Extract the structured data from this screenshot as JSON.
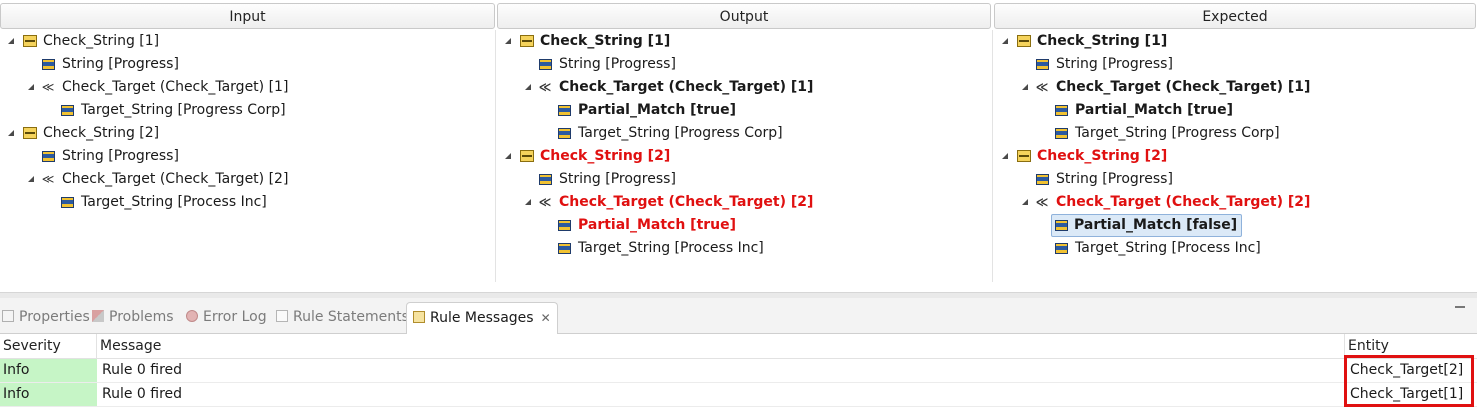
{
  "panels": {
    "input": {
      "title": "Input",
      "rows": [
        {
          "label": "Check_String [1]"
        },
        {
          "label": "String [Progress]"
        },
        {
          "label": "Check_Target (Check_Target) [1]"
        },
        {
          "label": "Target_String [Progress Corp]"
        },
        {
          "label": "Check_String [2]"
        },
        {
          "label": "String [Progress]"
        },
        {
          "label": "Check_Target (Check_Target) [2]"
        },
        {
          "label": "Target_String [Process Inc]"
        }
      ]
    },
    "output": {
      "title": "Output",
      "rows": [
        {
          "label": "Check_String [1]"
        },
        {
          "label": "String [Progress]"
        },
        {
          "label": "Check_Target (Check_Target) [1]"
        },
        {
          "label": "Partial_Match [true]"
        },
        {
          "label": "Target_String [Progress Corp]"
        },
        {
          "label": "Check_String [2]"
        },
        {
          "label": "String [Progress]"
        },
        {
          "label": "Check_Target (Check_Target) [2]"
        },
        {
          "label": "Partial_Match [true]"
        },
        {
          "label": "Target_String [Process Inc]"
        }
      ]
    },
    "expected": {
      "title": "Expected",
      "rows": [
        {
          "label": "Check_String [1]"
        },
        {
          "label": "String [Progress]"
        },
        {
          "label": "Check_Target (Check_Target) [1]"
        },
        {
          "label": "Partial_Match [true]"
        },
        {
          "label": "Target_String [Progress Corp]"
        },
        {
          "label": "Check_String [2]"
        },
        {
          "label": "String [Progress]"
        },
        {
          "label": "Check_Target (Check_Target) [2]"
        },
        {
          "label": "Partial_Match [false]"
        },
        {
          "label": "Target_String [Process Inc]"
        }
      ]
    }
  },
  "tabs": [
    {
      "label": "Properties",
      "icon": "properties-icon"
    },
    {
      "label": "Problems",
      "icon": "problems-icon"
    },
    {
      "label": "Error Log",
      "icon": "error-log-icon"
    },
    {
      "label": "Rule Statements",
      "icon": "rule-statements-icon"
    },
    {
      "label": "Rule Messages",
      "icon": "envelope-icon",
      "active": true
    }
  ],
  "table": {
    "columns": [
      "Severity",
      "Message",
      "Entity"
    ],
    "rows": [
      {
        "severity": "Info",
        "message": "Rule 0 fired",
        "entity": "Check_Target[2]"
      },
      {
        "severity": "Info",
        "message": "Rule 0 fired",
        "entity": "Check_Target[1]"
      }
    ]
  },
  "colors": {
    "mismatch": "#e01010",
    "info_severity_bg": "#c6f5c6",
    "highlight_box": "#e01010"
  }
}
